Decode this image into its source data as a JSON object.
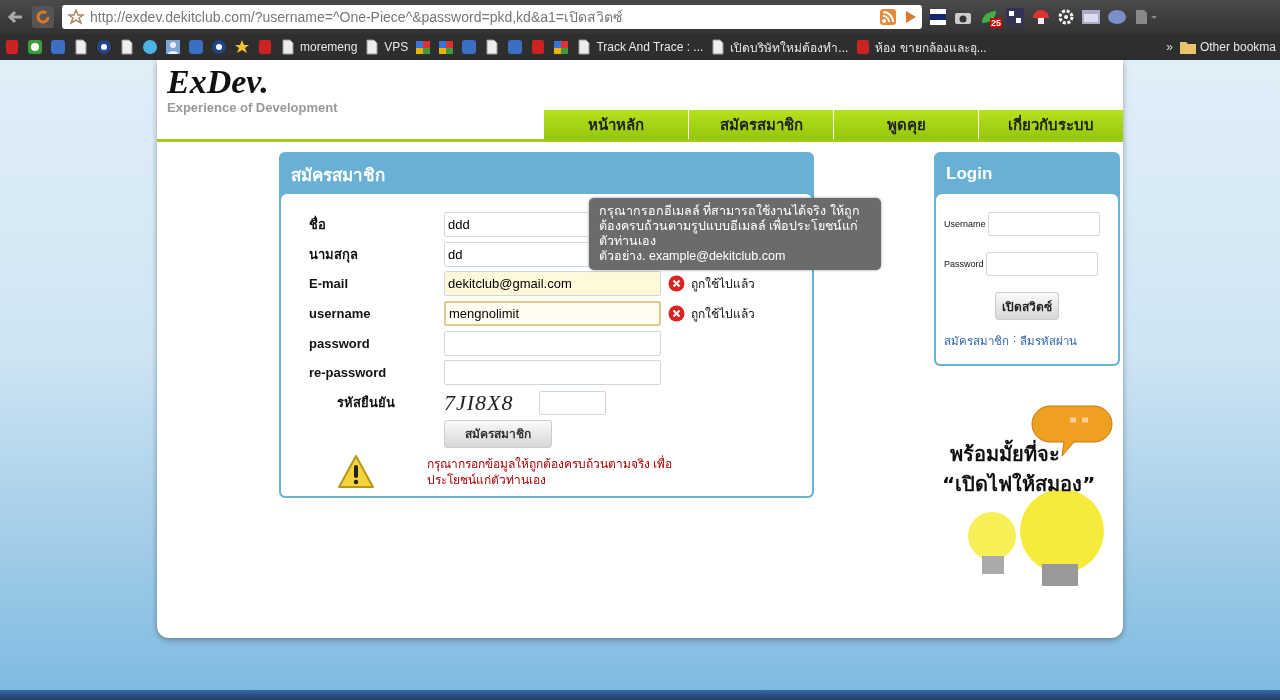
{
  "browser": {
    "address": "http://exdev.dekitclub.com/?username=^One-Piece^&password=pkd,kd&a1=เปิดสวิตซ์",
    "bookmarks": [
      {
        "label": "moremeng"
      },
      {
        "label": "VPS"
      },
      {
        "label": "Track And Trace : ..."
      },
      {
        "label": "เปิดบริษัทใหม่ต้องทำ..."
      },
      {
        "label": "ห้อง ขายกล้องและอุ..."
      }
    ],
    "more": "»",
    "other_bookmarks": "Other bookma",
    "extension_badge": "25"
  },
  "site": {
    "logo": "ExDev.",
    "tagline": "Experience of Development",
    "nav": [
      {
        "label": "หน้าหลัก"
      },
      {
        "label": "สมัครสมาชิก"
      },
      {
        "label": "พูดคุย"
      },
      {
        "label": "เกี่ยวกับระบบ"
      }
    ]
  },
  "register": {
    "title": "สมัครสมาชิก",
    "fields": [
      {
        "label": "ชื่อ",
        "value": "ddd",
        "autofilled": false,
        "focused": false
      },
      {
        "label": "นามสกุล",
        "value": "dd",
        "autofilled": false,
        "focused": false
      },
      {
        "label": "E-mail",
        "value": "dekitclub@gmail.com",
        "autofilled": true,
        "focused": false,
        "error": "ถูกใช้ไปแล้ว"
      },
      {
        "label": "username",
        "value": "mengnolimit",
        "autofilled": false,
        "focused": true,
        "error": "ถูกใช้ไปแล้ว"
      },
      {
        "label": "password",
        "autofilled": false,
        "focused": false
      },
      {
        "label": "re-password",
        "autofilled": false,
        "focused": false
      }
    ],
    "captcha": {
      "label": "รหัสยืนยัน",
      "code": "7JI8X8"
    },
    "submit": "สมัครสมาชิก",
    "warning": "กรุณากรอกข้อมูลให้ถูกต้องครบถ้วนตามจริง เพื่อประโยชน์แก่ตัวท่านเอง",
    "tooltip": {
      "text": "กรุณากรอกอีเมลล์ ที่สามารถใช้งานได้จริง ให้ถูกต้องครบถ้วนตามรูปแบบอีเมลล์ เพื่อประโยชน์แก่ตัวท่านเอง",
      "example": "ตัวอย่าง. example@dekitclub.com"
    }
  },
  "login": {
    "title": "Login",
    "username_label": "Username",
    "password_label": "Password",
    "button": "เปิดสวิตซ์",
    "links": [
      {
        "label": "สมัครสมาชิก"
      },
      {
        "label": "ลืมรหัสผ่าน"
      }
    ],
    "separator": ":"
  },
  "promo": {
    "line1": "พร้อมมั้ยที่จะ",
    "line2": "“เปิดไฟให้สมอง”"
  }
}
